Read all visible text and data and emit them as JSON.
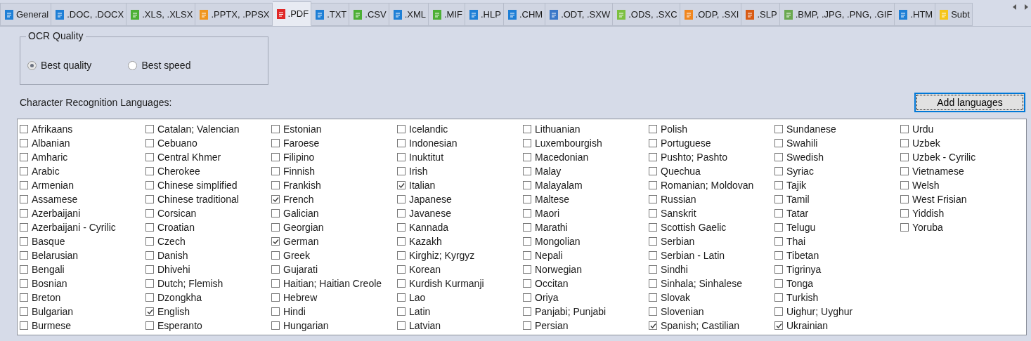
{
  "tabs": [
    {
      "label": "General",
      "selected": false,
      "color": "#1e7fd6"
    },
    {
      "label": ".DOC, .DOCX",
      "selected": false,
      "color": "#1e7fd6"
    },
    {
      "label": ".XLS, .XLSX",
      "selected": false,
      "color": "#4caf35"
    },
    {
      "label": ".PPTX, .PPSX",
      "selected": false,
      "color": "#f0961e"
    },
    {
      "label": ".PDF",
      "selected": true,
      "color": "#e02828"
    },
    {
      "label": ".TXT",
      "selected": false,
      "color": "#1e7fd6"
    },
    {
      "label": ".CSV",
      "selected": false,
      "color": "#4caf35"
    },
    {
      "label": ".XML",
      "selected": false,
      "color": "#1e7fd6"
    },
    {
      "label": ".MIF",
      "selected": false,
      "color": "#4caf35"
    },
    {
      "label": ".HLP",
      "selected": false,
      "color": "#1e7fd6"
    },
    {
      "label": ".CHM",
      "selected": false,
      "color": "#1e7fd6"
    },
    {
      "label": ".ODT, .SXW",
      "selected": false,
      "color": "#3a78c8"
    },
    {
      "label": ".ODS, .SXC",
      "selected": false,
      "color": "#7cc040"
    },
    {
      "label": ".ODP, .SXI",
      "selected": false,
      "color": "#f0861e"
    },
    {
      "label": ".SLP",
      "selected": false,
      "color": "#d85a14"
    },
    {
      "label": ".BMP, .JPG, .PNG, .GIF",
      "selected": false,
      "color": "#6aa84f"
    },
    {
      "label": ".HTM",
      "selected": false,
      "color": "#1e7fd6"
    },
    {
      "label": "Subt",
      "selected": false,
      "color": "#f5c518"
    }
  ],
  "ocr_quality": {
    "title": "OCR Quality",
    "options": [
      {
        "label": "Best quality",
        "selected": true
      },
      {
        "label": "Best speed",
        "selected": false
      }
    ]
  },
  "languages_label": "Character Recognition Languages:",
  "add_button": "Add languages",
  "languages": [
    {
      "label": "Afrikaans",
      "checked": false
    },
    {
      "label": "Albanian",
      "checked": false
    },
    {
      "label": "Amharic",
      "checked": false
    },
    {
      "label": "Arabic",
      "checked": false
    },
    {
      "label": "Armenian",
      "checked": false
    },
    {
      "label": "Assamese",
      "checked": false
    },
    {
      "label": "Azerbaijani",
      "checked": false
    },
    {
      "label": "Azerbaijani - Cyrilic",
      "checked": false
    },
    {
      "label": "Basque",
      "checked": false
    },
    {
      "label": "Belarusian",
      "checked": false
    },
    {
      "label": "Bengali",
      "checked": false
    },
    {
      "label": "Bosnian",
      "checked": false
    },
    {
      "label": "Breton",
      "checked": false
    },
    {
      "label": "Bulgarian",
      "checked": false
    },
    {
      "label": "Burmese",
      "checked": false
    },
    {
      "label": "Catalan; Valencian",
      "checked": false
    },
    {
      "label": "Cebuano",
      "checked": false
    },
    {
      "label": "Central Khmer",
      "checked": false
    },
    {
      "label": "Cherokee",
      "checked": false
    },
    {
      "label": "Chinese simplified",
      "checked": false
    },
    {
      "label": "Chinese traditional",
      "checked": false
    },
    {
      "label": "Corsican",
      "checked": false
    },
    {
      "label": "Croatian",
      "checked": false
    },
    {
      "label": "Czech",
      "checked": false
    },
    {
      "label": "Danish",
      "checked": false
    },
    {
      "label": "Dhivehi",
      "checked": false
    },
    {
      "label": "Dutch; Flemish",
      "checked": false
    },
    {
      "label": "Dzongkha",
      "checked": false
    },
    {
      "label": "English",
      "checked": true
    },
    {
      "label": "Esperanto",
      "checked": false
    },
    {
      "label": "Estonian",
      "checked": false
    },
    {
      "label": "Faroese",
      "checked": false
    },
    {
      "label": "Filipino",
      "checked": false
    },
    {
      "label": "Finnish",
      "checked": false
    },
    {
      "label": "Frankish",
      "checked": false
    },
    {
      "label": "French",
      "checked": true
    },
    {
      "label": "Galician",
      "checked": false
    },
    {
      "label": "Georgian",
      "checked": false
    },
    {
      "label": "German",
      "checked": true
    },
    {
      "label": "Greek",
      "checked": false
    },
    {
      "label": "Gujarati",
      "checked": false
    },
    {
      "label": "Haitian; Haitian Creole",
      "checked": false
    },
    {
      "label": "Hebrew",
      "checked": false
    },
    {
      "label": "Hindi",
      "checked": false
    },
    {
      "label": "Hungarian",
      "checked": false
    },
    {
      "label": "Icelandic",
      "checked": false
    },
    {
      "label": "Indonesian",
      "checked": false
    },
    {
      "label": "Inuktitut",
      "checked": false
    },
    {
      "label": "Irish",
      "checked": false
    },
    {
      "label": "Italian",
      "checked": true
    },
    {
      "label": "Japanese",
      "checked": false
    },
    {
      "label": "Javanese",
      "checked": false
    },
    {
      "label": "Kannada",
      "checked": false
    },
    {
      "label": "Kazakh",
      "checked": false
    },
    {
      "label": "Kirghiz; Kyrgyz",
      "checked": false
    },
    {
      "label": "Korean",
      "checked": false
    },
    {
      "label": "Kurdish Kurmanji",
      "checked": false
    },
    {
      "label": "Lao",
      "checked": false
    },
    {
      "label": "Latin",
      "checked": false
    },
    {
      "label": "Latvian",
      "checked": false
    },
    {
      "label": "Lithuanian",
      "checked": false
    },
    {
      "label": "Luxembourgish",
      "checked": false
    },
    {
      "label": "Macedonian",
      "checked": false
    },
    {
      "label": "Malay",
      "checked": false
    },
    {
      "label": "Malayalam",
      "checked": false
    },
    {
      "label": "Maltese",
      "checked": false
    },
    {
      "label": "Maori",
      "checked": false
    },
    {
      "label": "Marathi",
      "checked": false
    },
    {
      "label": "Mongolian",
      "checked": false
    },
    {
      "label": "Nepali",
      "checked": false
    },
    {
      "label": "Norwegian",
      "checked": false
    },
    {
      "label": "Occitan",
      "checked": false
    },
    {
      "label": "Oriya",
      "checked": false
    },
    {
      "label": "Panjabi; Punjabi",
      "checked": false
    },
    {
      "label": "Persian",
      "checked": false
    },
    {
      "label": "Polish",
      "checked": false
    },
    {
      "label": "Portuguese",
      "checked": false
    },
    {
      "label": "Pushto; Pashto",
      "checked": false
    },
    {
      "label": "Quechua",
      "checked": false
    },
    {
      "label": "Romanian; Moldovan",
      "checked": false
    },
    {
      "label": "Russian",
      "checked": false
    },
    {
      "label": "Sanskrit",
      "checked": false
    },
    {
      "label": "Scottish Gaelic",
      "checked": false
    },
    {
      "label": "Serbian",
      "checked": false
    },
    {
      "label": "Serbian - Latin",
      "checked": false
    },
    {
      "label": "Sindhi",
      "checked": false
    },
    {
      "label": "Sinhala; Sinhalese",
      "checked": false
    },
    {
      "label": "Slovak",
      "checked": false
    },
    {
      "label": "Slovenian",
      "checked": false
    },
    {
      "label": "Spanish; Castilian",
      "checked": true
    },
    {
      "label": "Sundanese",
      "checked": false
    },
    {
      "label": "Swahili",
      "checked": false
    },
    {
      "label": "Swedish",
      "checked": false
    },
    {
      "label": "Syriac",
      "checked": false
    },
    {
      "label": "Tajik",
      "checked": false
    },
    {
      "label": "Tamil",
      "checked": false
    },
    {
      "label": "Tatar",
      "checked": false
    },
    {
      "label": "Telugu",
      "checked": false
    },
    {
      "label": "Thai",
      "checked": false
    },
    {
      "label": "Tibetan",
      "checked": false
    },
    {
      "label": "Tigrinya",
      "checked": false
    },
    {
      "label": "Tonga",
      "checked": false
    },
    {
      "label": "Turkish",
      "checked": false
    },
    {
      "label": "Uighur; Uyghur",
      "checked": false
    },
    {
      "label": "Ukrainian",
      "checked": true
    },
    {
      "label": "Urdu",
      "checked": false
    },
    {
      "label": "Uzbek",
      "checked": false
    },
    {
      "label": "Uzbek - Cyrilic",
      "checked": false
    },
    {
      "label": "Vietnamese",
      "checked": false
    },
    {
      "label": "Welsh",
      "checked": false
    },
    {
      "label": "West Frisian",
      "checked": false
    },
    {
      "label": "Yiddish",
      "checked": false
    },
    {
      "label": "Yoruba",
      "checked": false
    }
  ]
}
